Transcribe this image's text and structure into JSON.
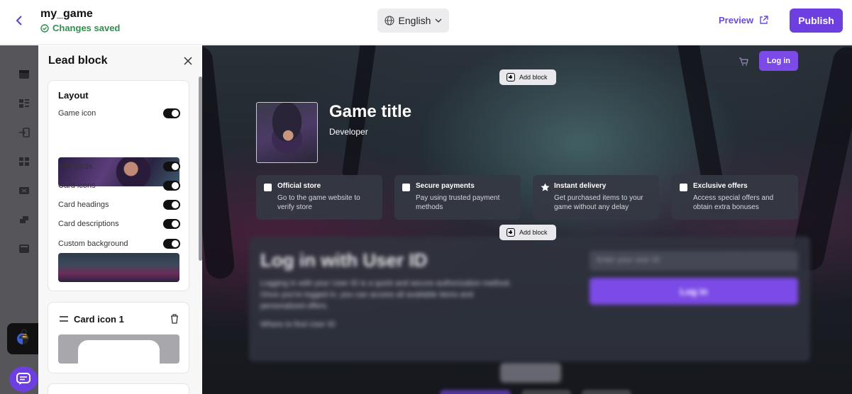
{
  "header": {
    "project_name": "my_game",
    "save_status": "Changes saved",
    "language": "English",
    "preview_label": "Preview",
    "publish_label": "Publish"
  },
  "panel": {
    "title": "Lead block",
    "layout": {
      "heading": "Layout",
      "rows": [
        {
          "label": "Game icon",
          "enabled": true
        },
        {
          "label": "Info cards",
          "enabled": true
        },
        {
          "label": "Card icons",
          "enabled": true
        },
        {
          "label": "Card headings",
          "enabled": true
        },
        {
          "label": "Card descriptions",
          "enabled": true
        },
        {
          "label": "Custom background",
          "enabled": true
        }
      ]
    },
    "card_icon": {
      "title": "Card icon 1"
    }
  },
  "canvas": {
    "login_label": "Log in",
    "add_block_label": "Add block",
    "game_title": "Game title",
    "developer": "Developer",
    "info_cards": [
      {
        "icon": "store-icon",
        "heading": "Official store",
        "description": "Go to the game website to verify store"
      },
      {
        "icon": "lock-icon",
        "heading": "Secure payments",
        "description": "Pay using trusted payment methods"
      },
      {
        "icon": "star-icon",
        "heading": "Instant delivery",
        "description": "Get purchased items to your game without any delay"
      },
      {
        "icon": "basket-icon",
        "heading": "Exclusive offers",
        "description": "Access special offers and obtain extra bonuses"
      }
    ],
    "login_section": {
      "title": "Log in with User ID",
      "description": "Logging in with your User ID is a quick and secure authorization method. Once you're logged in, you can access all available items and personalized offers.",
      "help_link": "Where to find User ID",
      "input_placeholder": "Enter your user ID",
      "button_label": "Log in"
    }
  },
  "colors": {
    "accent": "#6e3fe0",
    "success": "#2f8f4e",
    "toggle_on": "#111111"
  }
}
